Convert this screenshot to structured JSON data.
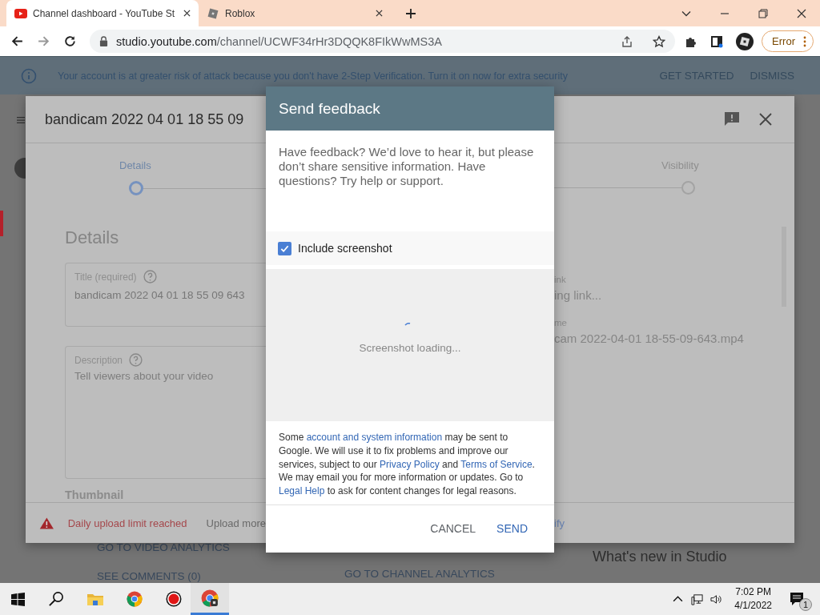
{
  "browser": {
    "tabs": [
      {
        "title": "Channel dashboard - YouTube St",
        "selected": true
      },
      {
        "title": "Roblox",
        "selected": false
      }
    ],
    "url_host": "studio.youtube.com",
    "url_path": "/channel/UCWF34rHr3DQQK8FIkWwMS3A",
    "error_button": "Error"
  },
  "banner": {
    "text": "Your account is at greater risk of attack because you don't have 2-Step Verification. Turn it on now for extra security",
    "actions": [
      "GET STARTED",
      "DISMISS"
    ]
  },
  "upload_dialog": {
    "title": "bandicam 2022 04 01 18 55 09",
    "steps": [
      {
        "label": "Details",
        "selected": true
      },
      {
        "label": "Visibility",
        "selected": false
      }
    ],
    "heading": "Details",
    "title_field": {
      "label": "Title (required)",
      "value": "bandicam 2022 04 01 18 55 09 643"
    },
    "description_field": {
      "label": "Description",
      "placeholder": "Tell viewers about your video"
    },
    "thumbnail_heading": "Thumbnail",
    "link_label": "ink",
    "link_value": "ing link...",
    "filename_label": "me",
    "filename": "cam 2022-04-01 18-55-09-643.mp4",
    "warning": "Daily upload limit reached",
    "upload_more": "Upload more",
    "verify_link": "ify"
  },
  "background": {
    "links": [
      "GO TO VIDEO ANALYTICS",
      "SEE COMMENTS (0)",
      "GO TO CHANNEL ANALYTICS"
    ],
    "whats_new": "What's new in Studio"
  },
  "feedback": {
    "title": "Send feedback",
    "intro": "Have feedback? We’d love to hear it, but please don’t share sensitive information. Have questions? Try help or support.",
    "include_screenshot": {
      "label": "Include screenshot",
      "checked": true
    },
    "loading": "Screenshot loading...",
    "legal": [
      {
        "text": "Some ",
        "kind": "text"
      },
      {
        "text": "account and system information",
        "kind": "link"
      },
      {
        "text": " may be sent to Google. We will use it to fix problems and improve our services, subject to our ",
        "kind": "text"
      },
      {
        "text": "Privacy Policy",
        "kind": "link"
      },
      {
        "text": " and ",
        "kind": "text"
      },
      {
        "text": "Terms of Service",
        "kind": "link"
      },
      {
        "text": ". We may email you for more information or updates. Go to ",
        "kind": "text"
      },
      {
        "text": "Legal Help",
        "kind": "link"
      },
      {
        "text": " to ask for content changes for legal reasons.",
        "kind": "text"
      }
    ],
    "buttons": [
      {
        "label": "CANCEL",
        "kind": "secondary"
      },
      {
        "label": "SEND",
        "kind": "primary"
      }
    ]
  },
  "taskbar": {
    "time": "7:02 PM",
    "date": "4/1/2022",
    "notification_count": "1"
  }
}
